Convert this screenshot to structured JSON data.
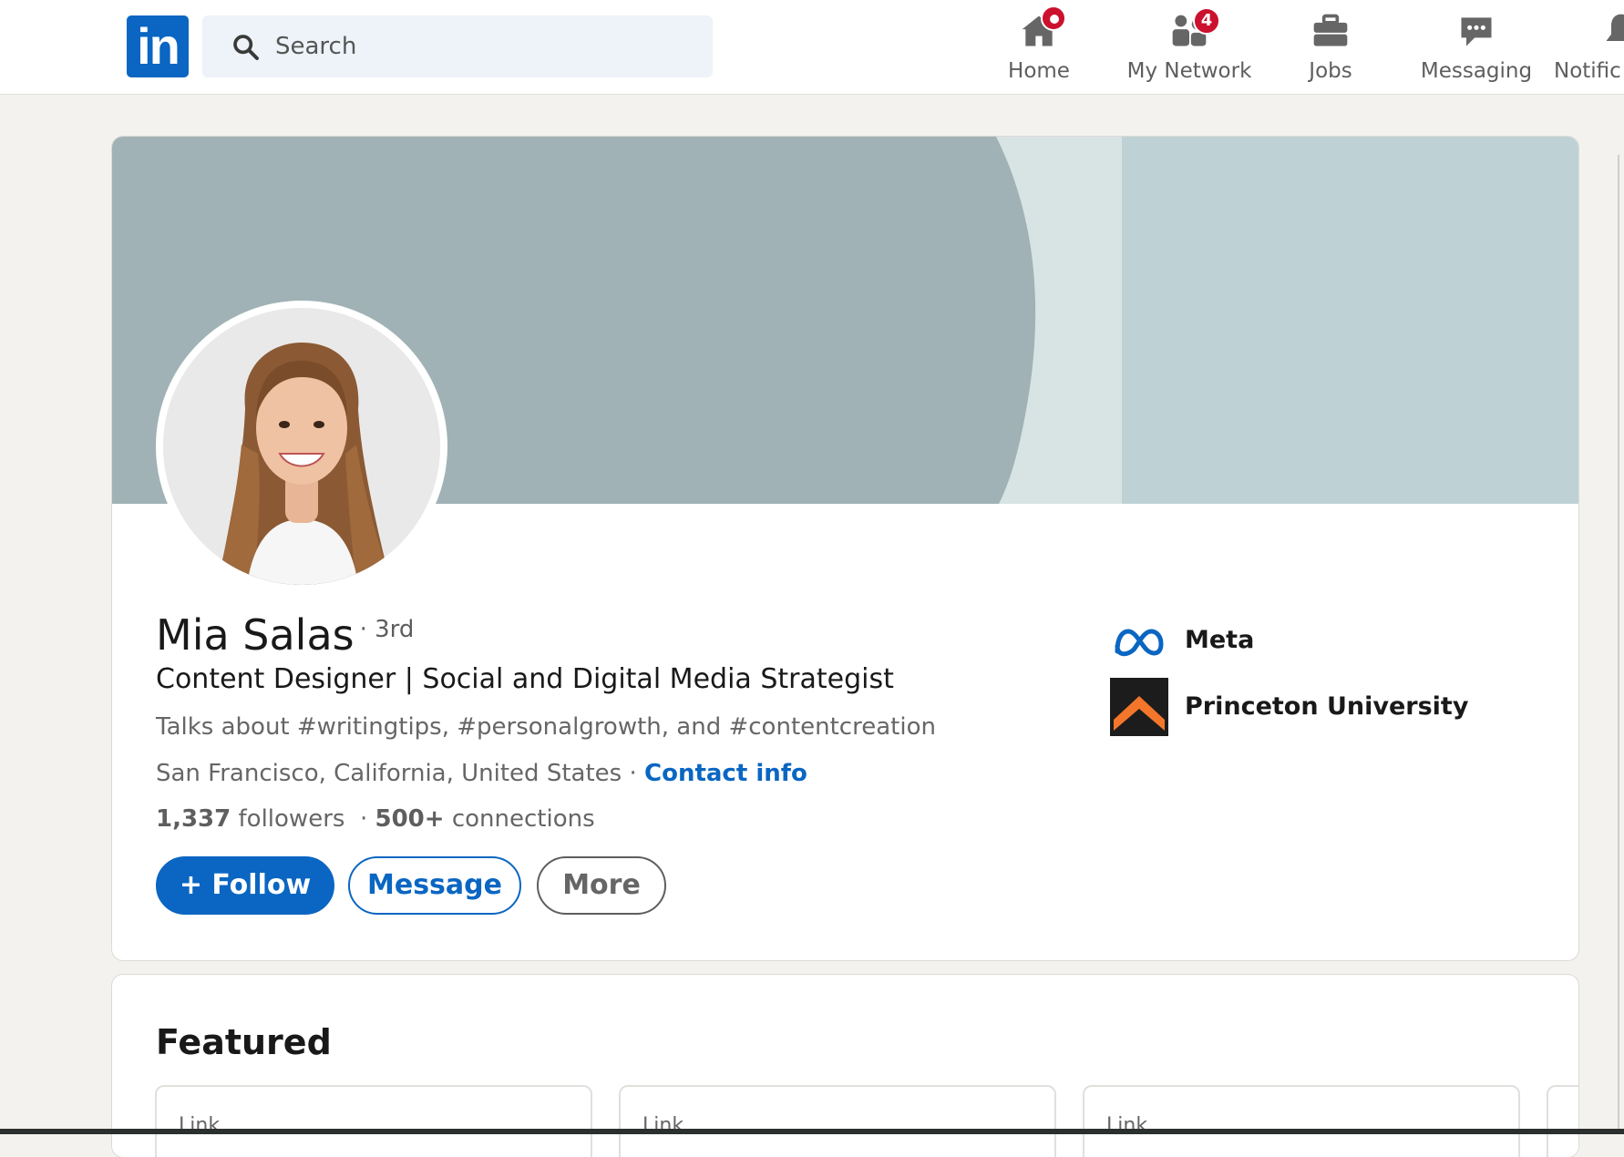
{
  "nav": {
    "logo_text": "in",
    "search_placeholder": "Search",
    "items": [
      {
        "label": "Home",
        "icon": "home-icon",
        "badge": ""
      },
      {
        "label": "My Network",
        "icon": "network-icon",
        "badge": "4"
      },
      {
        "label": "Jobs",
        "icon": "briefcase-icon",
        "badge": ""
      },
      {
        "label": "Messaging",
        "icon": "messaging-icon",
        "badge": ""
      },
      {
        "label": "Notific",
        "icon": "bell-icon",
        "badge": ""
      }
    ]
  },
  "profile": {
    "name": "Mia Salas",
    "degree": "· 3rd",
    "headline": "Content Designer | Social and Digital Media Strategist",
    "talks_about": "Talks about #writingtips, #personalgrowth, and #contentcreation",
    "location": "San Francisco, California, United States",
    "location_sep": " · ",
    "contact_label": "Contact info",
    "followers_count": "1,337",
    "followers_label": " followers",
    "connections_sep": "  · ",
    "connections_count": "500+",
    "connections_label": " connections",
    "actions": {
      "follow": "+ Follow",
      "message": "Message",
      "more": "More"
    },
    "organizations": [
      {
        "name": "Meta",
        "icon": "meta-logo-icon"
      },
      {
        "name": "Princeton University",
        "icon": "princeton-logo-icon"
      }
    ]
  },
  "featured": {
    "title": "Featured",
    "items": [
      {
        "label": "Link"
      },
      {
        "label": "Link"
      },
      {
        "label": "Link"
      }
    ]
  },
  "colors": {
    "brand": "#0a66c2",
    "badge": "#cb112d",
    "banner_dark": "#a0b2b5",
    "banner_mid": "#d8e3e4",
    "banner_light": "#bed2d5"
  }
}
